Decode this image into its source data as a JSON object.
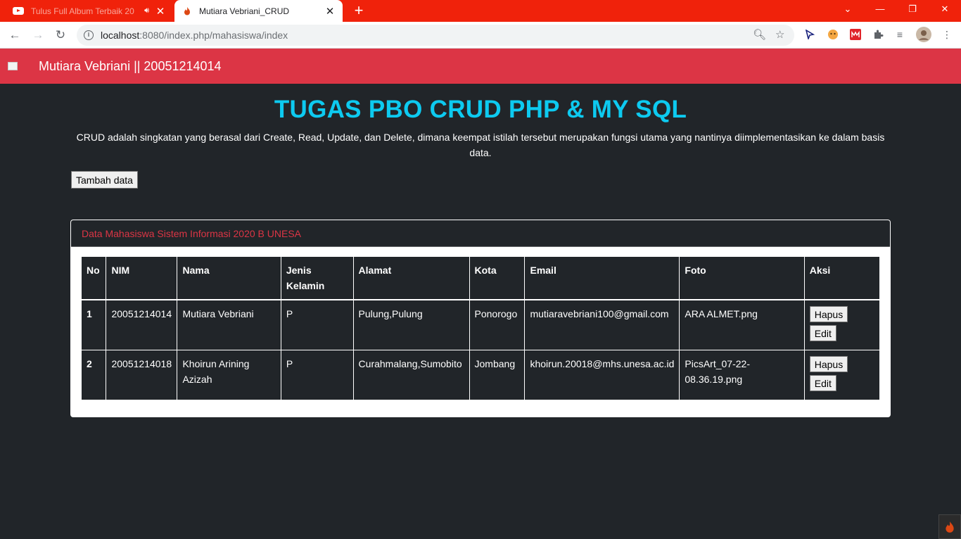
{
  "browser": {
    "tabs": [
      {
        "title": "Tulus Full Album Terbaik 20",
        "active": false
      },
      {
        "title": "Mutiara Vebriani_CRUD",
        "active": true
      }
    ],
    "url_host": "localhost",
    "url_rest": ":8080/index.php/mahasiswa/index",
    "accent": "#f0220b"
  },
  "navbar": {
    "brand": "Mutiara Vebriani || 20051214014",
    "color": "#dc3545"
  },
  "main": {
    "title": "TUGAS PBO CRUD PHP & MY SQL",
    "description": "CRUD adalah singkatan yang berasal dari Create, Read, Update, dan Delete, dimana keempat istilah tersebut merupakan fungsi utama yang nantinya diimplementasikan ke dalam basis data.",
    "add_button": "Tambah data"
  },
  "card": {
    "header": "Data Mahasiswa Sistem Informasi 2020 B UNESA",
    "columns": [
      "No",
      "NIM",
      "Nama",
      "Jenis Kelamin",
      "Alamat",
      "Kota",
      "Email",
      "Foto",
      "Aksi"
    ],
    "rows": [
      {
        "no": "1",
        "nim": "20051214014",
        "nama": "Mutiara Vebriani",
        "jk": "P",
        "alamat": "Pulung,Pulung",
        "kota": "Ponorogo",
        "email": "mutiaravebriani100@gmail.com",
        "foto": "ARA ALMET.png"
      },
      {
        "no": "2",
        "nim": "20051214018",
        "nama": "Khoirun Arining Azizah",
        "jk": "P",
        "alamat": "Curahmalang,Sumobito",
        "kota": "Jombang",
        "email": "khoirun.20018@mhs.unesa.ac.id",
        "foto": "PicsArt_07-22-08.36.19.png"
      }
    ],
    "delete_label": "Hapus",
    "edit_label": "Edit"
  }
}
